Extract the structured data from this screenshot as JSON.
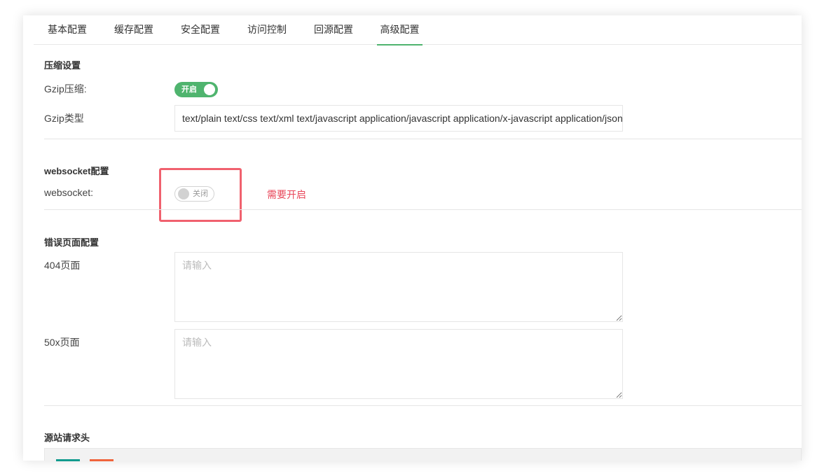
{
  "tabs": [
    {
      "label": "基本配置"
    },
    {
      "label": "缓存配置"
    },
    {
      "label": "安全配置"
    },
    {
      "label": "访问控制"
    },
    {
      "label": "回源配置"
    },
    {
      "label": "高级配置",
      "active": true
    }
  ],
  "compression": {
    "title": "压缩设置",
    "gzip_label": "Gzip压缩:",
    "gzip_switch_text": "开启",
    "gzip_enabled": true,
    "gzip_type_label": "Gzip类型",
    "gzip_type_value": "text/plain text/css text/xml text/javascript application/javascript application/x-javascript application/json"
  },
  "websocket": {
    "title": "websocket配置",
    "label": "websocket:",
    "switch_text": "关闭",
    "enabled": false,
    "hint": "需要开启"
  },
  "error_pages": {
    "title": "错误页面配置",
    "page_404_label": "404页面",
    "page_404_placeholder": "请输入",
    "page_50x_label": "50x页面",
    "page_50x_placeholder": "请输入"
  },
  "origin_headers": {
    "title": "源站请求头"
  },
  "colors": {
    "accent_green": "#4fb46e",
    "highlight_red": "#f0616e",
    "hint_red": "#e8475a",
    "button_teal": "#129b8e",
    "button_orange": "#f0643c"
  }
}
